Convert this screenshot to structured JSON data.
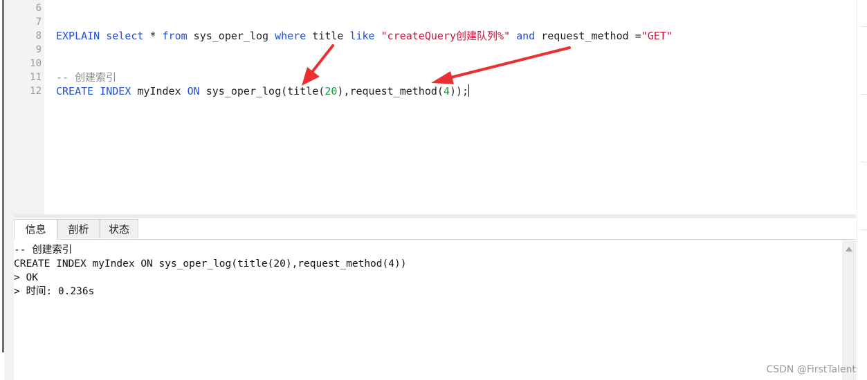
{
  "editor": {
    "lines": [
      {
        "num": "6"
      },
      {
        "num": "7"
      },
      {
        "num": "8"
      },
      {
        "num": "9"
      },
      {
        "num": "10"
      },
      {
        "num": "11"
      },
      {
        "num": "12"
      }
    ],
    "line8": {
      "kw_explain": "EXPLAIN",
      "kw_select": "select",
      "star": " * ",
      "kw_from": "from",
      "table": " sys_oper_log ",
      "kw_where": "where",
      "col_title": " title ",
      "kw_like": "like",
      "str_value": "\"createQuery创建队列%\"",
      "kw_and": "and",
      "col_method": " request_method =",
      "str_get": "\"GET\""
    },
    "line11": {
      "comment": "-- 创建索引"
    },
    "line12": {
      "kw_create": "CREATE",
      "kw_index": "INDEX",
      "index_name": " myIndex ",
      "kw_on": "ON",
      "table_part": " sys_oper_log(title(",
      "num_20": "20",
      "mid_part": "),request_method(",
      "num_4": "4",
      "end_part": "));"
    }
  },
  "tabs": [
    {
      "label": "信息"
    },
    {
      "label": "剖析"
    },
    {
      "label": "状态"
    }
  ],
  "output": {
    "lines": [
      "-- 创建索引",
      "CREATE INDEX myIndex ON sys_oper_log(title(20),request_method(4))",
      "> OK",
      "> 时间: 0.236s"
    ]
  },
  "watermark": "CSDN @FirstTalent",
  "colors": {
    "keyword": "#1f4fd1",
    "string": "#d0103a",
    "number": "#1a9a3a",
    "comment": "#8a8a8a",
    "annotation_arrow": "#ea3030"
  }
}
